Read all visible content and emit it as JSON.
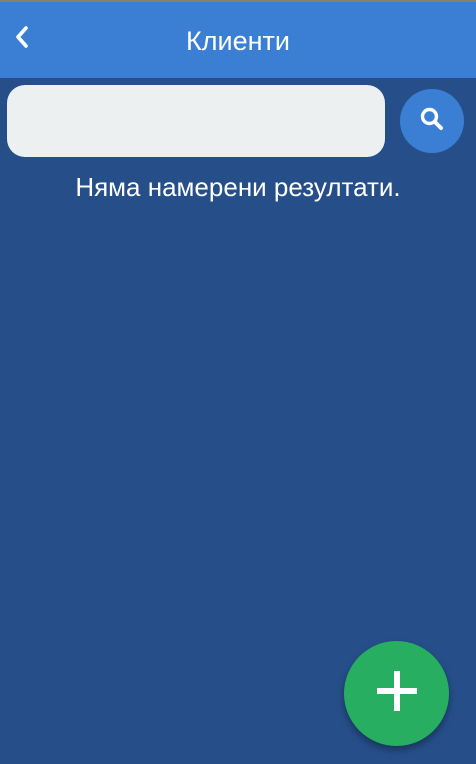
{
  "header": {
    "title": "Клиенти",
    "back_icon": "chevron-left-icon"
  },
  "search": {
    "value": "",
    "placeholder": "",
    "button_icon": "search-icon"
  },
  "results": {
    "empty_message": "Няма намерени резултати."
  },
  "fab": {
    "icon": "plus-icon",
    "color": "#27ae60"
  },
  "colors": {
    "background": "#264f8a",
    "header": "#3b7fd5",
    "accent": "#3b7fd5",
    "search_field": "#ecf0f1",
    "text": "#ffffff"
  }
}
